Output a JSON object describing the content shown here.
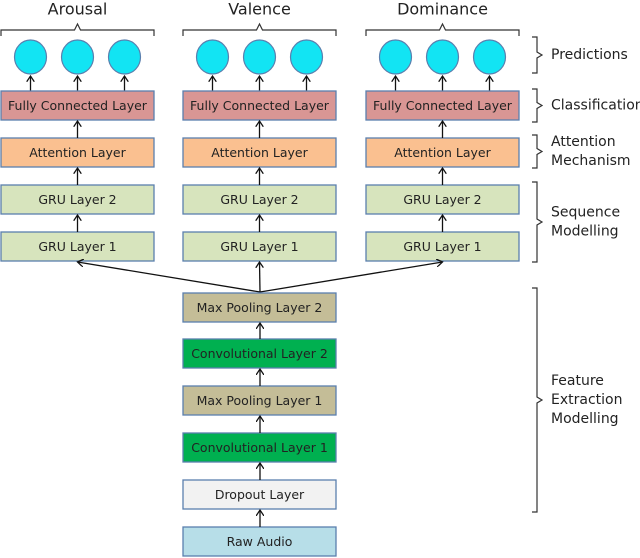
{
  "colors": {
    "fully_connected": "#d99694",
    "attention": "#fac090",
    "gru": "#d7e4bd",
    "max_pooling": "#c4bd97",
    "convolutional": "#00b050",
    "dropout": "#f2f2f2",
    "raw_audio": "#b7dee8",
    "prediction_node": "#12e4f3",
    "box_border": "#5a7fae"
  },
  "branches": [
    {
      "title": "Arousal",
      "layers": [
        "Fully Connected Layer",
        "Attention Layer",
        "GRU Layer 2",
        "GRU Layer 1"
      ]
    },
    {
      "title": "Valence",
      "layers": [
        "Fully Connected Layer",
        "Attention Layer",
        "GRU Layer 2",
        "GRU Layer 1"
      ]
    },
    {
      "title": "Dominance",
      "layers": [
        "Fully Connected Layer",
        "Attention Layer",
        "GRU Layer 2",
        "GRU Layer 1"
      ]
    }
  ],
  "trunk": [
    "Max Pooling Layer 2",
    "Convolutional Layer 2",
    "Max Pooling Layer 1",
    "Convolutional Layer 1",
    "Dropout Layer",
    "Raw Audio"
  ],
  "stages": [
    {
      "lines": [
        "Predictions"
      ]
    },
    {
      "lines": [
        "Classification"
      ]
    },
    {
      "lines": [
        "Attention",
        "Mechanism"
      ]
    },
    {
      "lines": [
        "Sequence",
        "Modelling"
      ]
    },
    {
      "lines": [
        "Feature",
        "Extraction",
        "Modelling"
      ]
    }
  ]
}
